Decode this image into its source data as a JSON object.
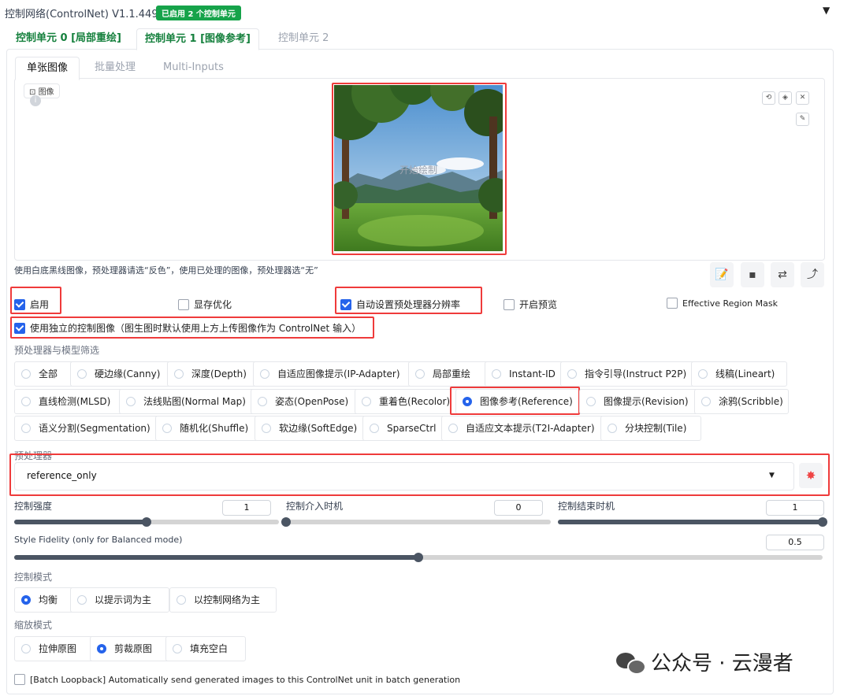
{
  "header": {
    "title": "控制网络(ControlNet) V1.1.449",
    "badge": "已启用 2 个控制单元",
    "collapse_icon": "▼"
  },
  "unit_tabs": [
    {
      "label": "控制单元 0 [局部重绘]"
    },
    {
      "label": "控制单元 1 [图像参考]"
    },
    {
      "label": "控制单元 2"
    }
  ],
  "image_tabs": [
    {
      "label": "单张图像"
    },
    {
      "label": "批量处理"
    },
    {
      "label": "Multi-Inputs"
    }
  ],
  "image": {
    "label": "图像",
    "caption": "开始绘制",
    "icons": [
      "undo-icon",
      "eraser-icon",
      "close-icon",
      "brush-icon"
    ]
  },
  "hint": "使用白底黑线图像，预处理器请选“反色”，使用已处理的图像，预处理器选“无”",
  "checkboxes": {
    "enable": "启用",
    "low_vram": "显存优化",
    "pixel_perfect": "自动设置预处理器分辨率",
    "allow_preview": "开启预览",
    "effective_region_mask": "Effective Region Mask",
    "upload_independent": "使用独立的控制图像（图生图时默认使用上方上传图像作为 ControlNet 输入）",
    "batch_loopback": "[Batch Loopback] Automatically send generated images to this ControlNet unit in batch generation"
  },
  "control_type": {
    "label": "预处理器与模型筛选",
    "selected": "图像参考(Reference)",
    "options": [
      "全部",
      "硬边缘(Canny)",
      "深度(Depth)",
      "自适应图像提示(IP-Adapter)",
      "局部重绘",
      "Instant-ID",
      "指令引导(Instruct P2P)",
      "线稿(Lineart)",
      "直线检测(MLSD)",
      "法线贴图(Normal Map)",
      "姿态(OpenPose)",
      "重着色(Recolor)",
      "图像参考(Reference)",
      "图像提示(Revision)",
      "涂鸦(Scribble)",
      "语义分割(Segmentation)",
      "随机化(Shuffle)",
      "软边缘(SoftEdge)",
      "SparseCtrl",
      "自适应文本提示(T2I-Adapter)",
      "分块控制(Tile)"
    ]
  },
  "preprocessor": {
    "label": "预处理器",
    "value": "reference_only",
    "run_icon": "explosion-icon"
  },
  "sliders": {
    "weight": {
      "label": "控制强度",
      "value": "1",
      "fraction": 0.5
    },
    "start": {
      "label": "控制介入时机",
      "value": "0",
      "fraction": 0.0
    },
    "end": {
      "label": "控制结束时机",
      "value": "1",
      "fraction": 1.0
    },
    "style_fidelity": {
      "label": "Style Fidelity (only for Balanced mode)",
      "value": "0.5",
      "fraction": 0.5
    }
  },
  "control_mode": {
    "label": "控制模式",
    "options": [
      "均衡",
      "以提示词为主",
      "以控制网络为主"
    ],
    "selected": "均衡"
  },
  "resize_mode": {
    "label": "缩放模式",
    "options": [
      "拉伸原图",
      "剪裁原图",
      "填充空白"
    ],
    "selected": "剪裁原图"
  },
  "watermark": "公众号 · 云漫者",
  "colors": {
    "accent": "#2563eb",
    "enabled_green": "#16a34a",
    "highlight_red": "#ef3b3b"
  }
}
